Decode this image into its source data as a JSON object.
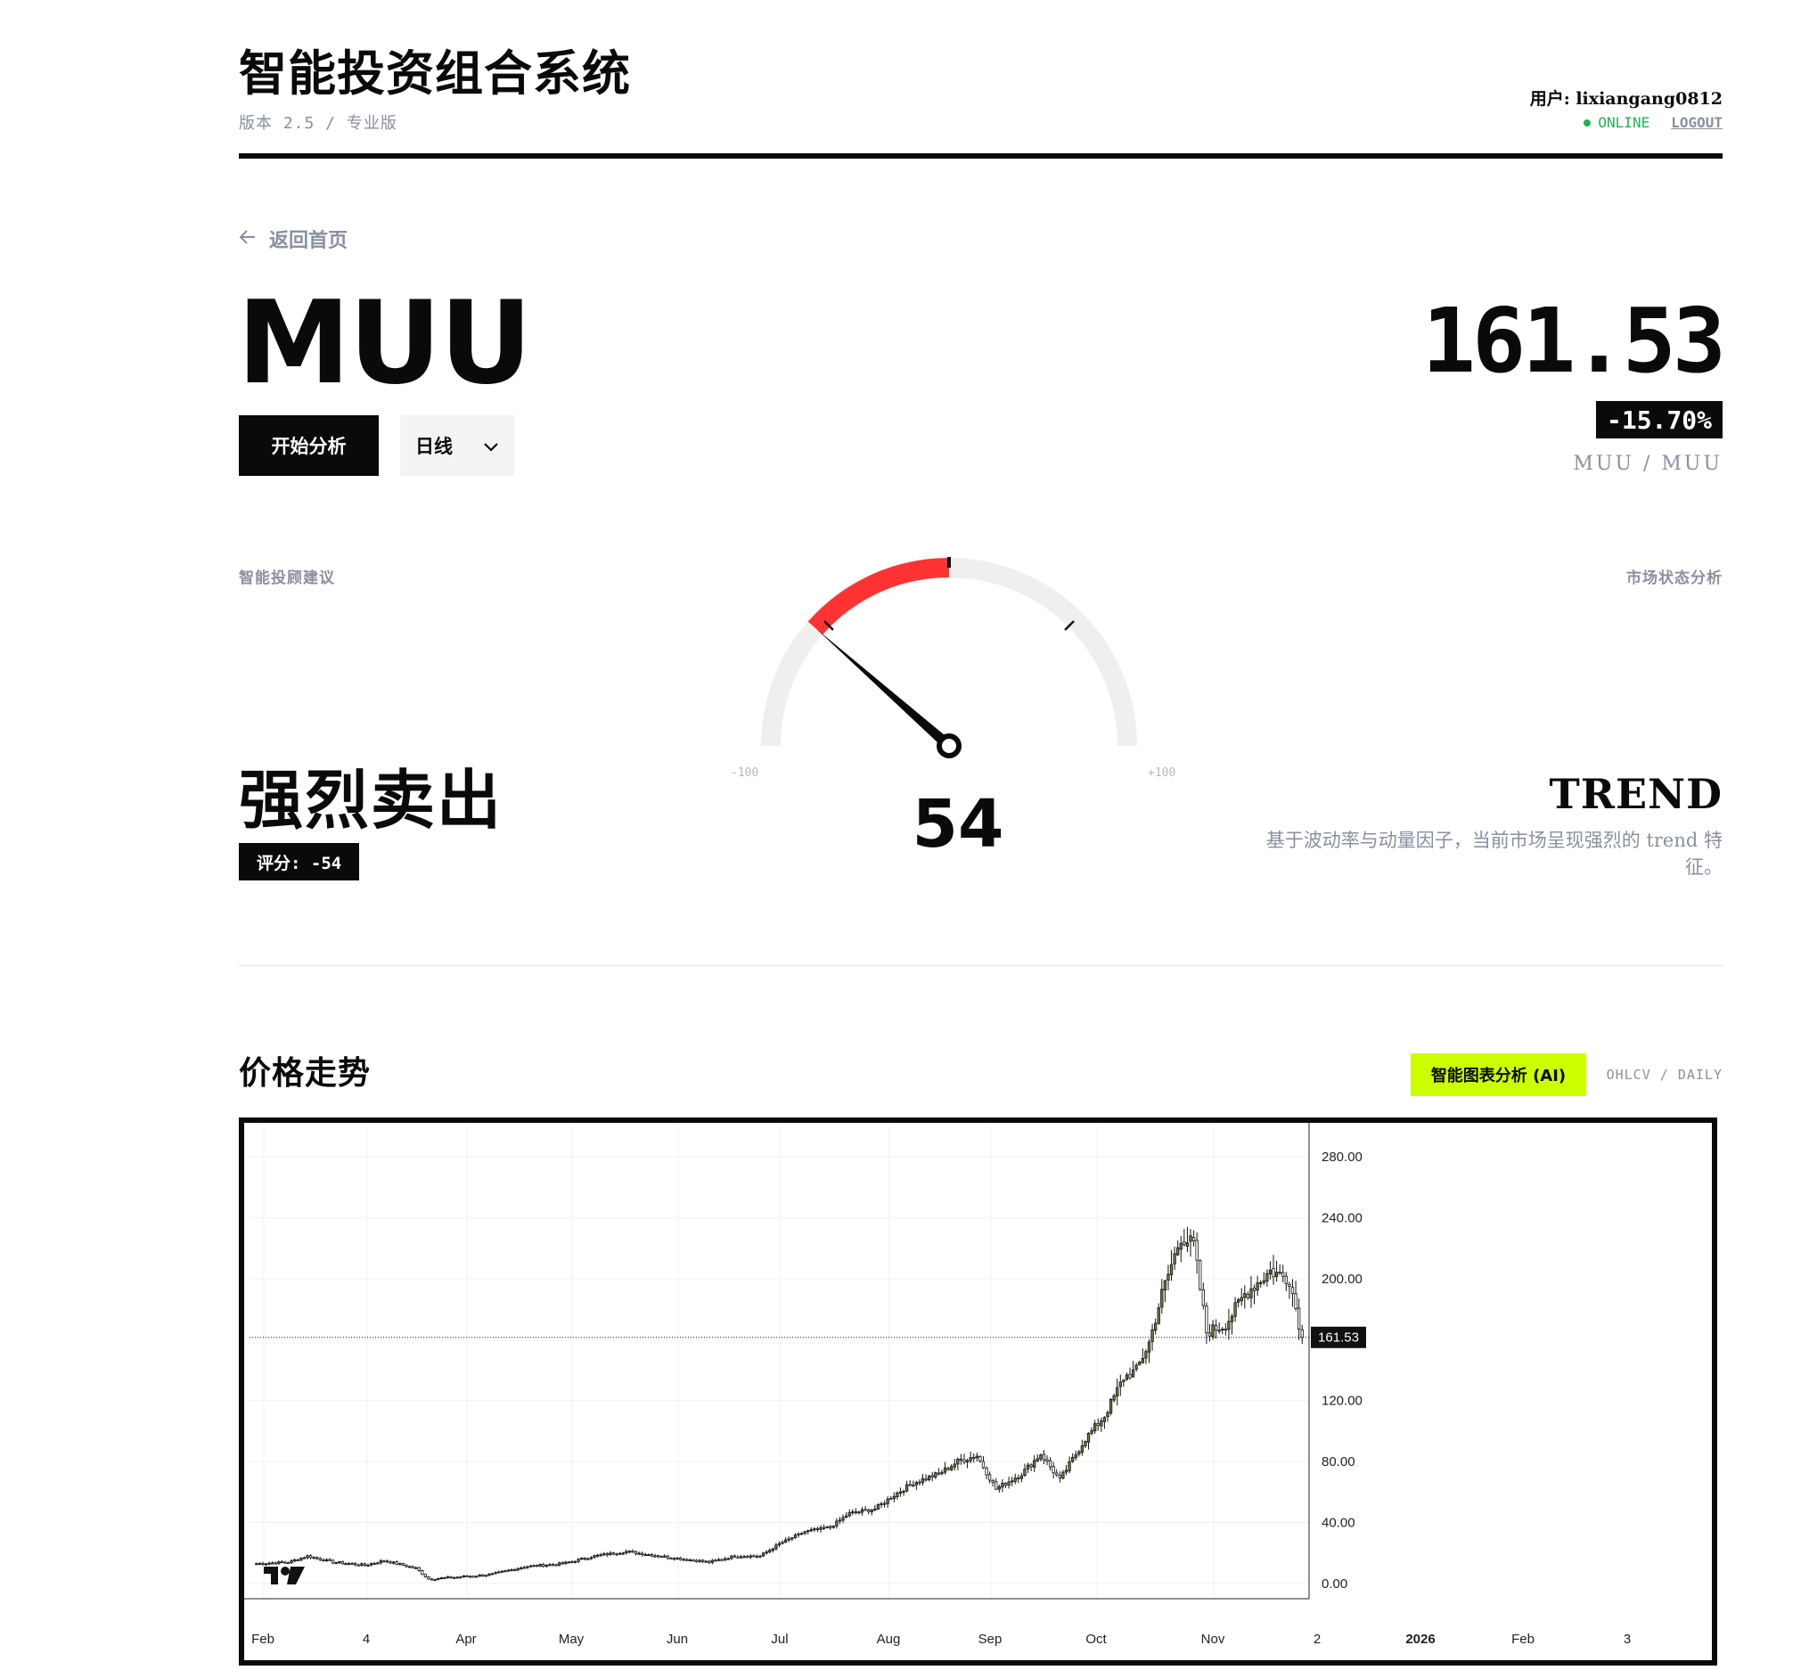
{
  "header": {
    "app_title": "智能投资组合系统",
    "version": "版本 2.5 / 专业版",
    "user": "用户: lixiangang0812",
    "status": "ONLINE",
    "logout": "LOGOUT",
    "status_color": "#22b24c"
  },
  "ticker": {
    "back_label": "返回首页",
    "symbol": "MUU",
    "analyze_button": "开始分析",
    "interval_selected": "日线",
    "price": "161.53",
    "change": "-15.70%",
    "pair": "MUU / MUU"
  },
  "advice": {
    "label": "智能投顾建议",
    "recommendation": "强烈卖出",
    "score_label": "评分: -54",
    "gauge_value": "54",
    "gauge_score": -54,
    "gauge_min": "-100",
    "gauge_max": "+100",
    "accent_color": "#ff3333"
  },
  "market": {
    "label": "市场状态分析",
    "state": "TREND",
    "description": "基于波动率与动量因子，当前市场呈现强烈的 trend 特征。"
  },
  "chart_section": {
    "title": "价格走势",
    "ai_button": "智能图表分析 (AI)",
    "ai_button_color": "#ccff00",
    "mode": "OHLCV / DAILY"
  },
  "chart_data": {
    "type": "candlestick",
    "x_tick_labels": [
      "Feb",
      "4",
      "Apr",
      "May",
      "Jun",
      "Jul",
      "Aug",
      "Sep",
      "Oct",
      "Nov",
      "2",
      "2026",
      "Feb",
      "3"
    ],
    "y_tick_labels": [
      "280.00",
      "240.00",
      "200.00",
      "160.00",
      "120.00",
      "80.00",
      "40.00",
      "0.00"
    ],
    "ylim": [
      -10,
      300
    ],
    "last_price_label": "161.53",
    "last_price": 161.53,
    "grid": true,
    "up_color": "#6b7d3a",
    "down_color": "#ffffff",
    "anchors": [
      [
        0,
        13
      ],
      [
        10,
        14
      ],
      [
        16,
        18
      ],
      [
        24,
        14
      ],
      [
        34,
        12
      ],
      [
        40,
        15
      ],
      [
        50,
        10
      ],
      [
        54,
        3
      ],
      [
        62,
        4
      ],
      [
        74,
        6
      ],
      [
        84,
        11
      ],
      [
        96,
        13
      ],
      [
        106,
        18
      ],
      [
        116,
        21
      ],
      [
        130,
        17
      ],
      [
        142,
        14
      ],
      [
        150,
        18
      ],
      [
        158,
        18
      ],
      [
        164,
        26
      ],
      [
        172,
        34
      ],
      [
        180,
        37
      ],
      [
        186,
        46
      ],
      [
        194,
        49
      ],
      [
        200,
        58
      ],
      [
        206,
        66
      ],
      [
        214,
        72
      ],
      [
        220,
        80
      ],
      [
        226,
        84
      ],
      [
        232,
        62
      ],
      [
        240,
        72
      ],
      [
        246,
        85
      ],
      [
        252,
        68
      ],
      [
        260,
        95
      ],
      [
        266,
        110
      ],
      [
        272,
        135
      ],
      [
        276,
        140
      ],
      [
        280,
        158
      ],
      [
        284,
        190
      ],
      [
        290,
        228
      ],
      [
        294,
        222
      ],
      [
        298,
        165
      ],
      [
        304,
        170
      ],
      [
        310,
        190
      ],
      [
        318,
        205
      ],
      [
        324,
        200
      ],
      [
        328,
        161.53
      ]
    ],
    "candle_count": 329
  }
}
